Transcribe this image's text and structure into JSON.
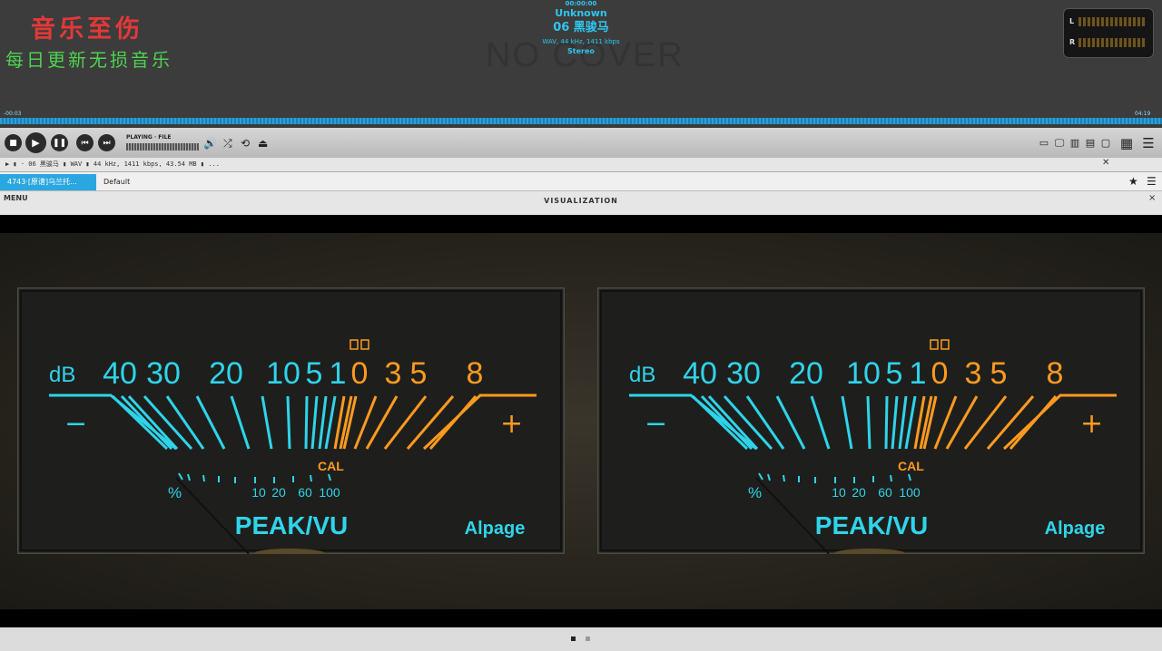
{
  "watermark": {
    "line1": "音乐至伤",
    "line2": "每日更新无损音乐"
  },
  "now_playing": {
    "time": "00:00:00",
    "artist": "Unknown",
    "title": "06 黑骏马",
    "format": "WAV, 44 kHz, 1411 kbps",
    "channels": "Stereo",
    "cover_text": "NO COVER"
  },
  "level_meter": {
    "left_label": "L",
    "right_label": "R"
  },
  "seek": {
    "elapsed": "-00:03",
    "remaining": "04:19"
  },
  "controls": {
    "status_label": "PLAYING · FILE"
  },
  "info_bar": {
    "text": "▶ ▮ · 06 黑骏马 ▮ WAV ▮ 44 kHz, 1411 kbps, 43.54 MB ▮ ..."
  },
  "tabs": [
    {
      "label": "4743·[原谱]乌兰托..."
    },
    {
      "label": "Default"
    }
  ],
  "panel": {
    "menu_label": "MENU",
    "title": "VISUALIZATION",
    "close": "×"
  },
  "meters": [
    {
      "db_label": "dB",
      "scale_cyan": [
        "40",
        "30",
        "20",
        "10",
        "5",
        "1"
      ],
      "scale_orange": [
        "0",
        "3",
        "5",
        "8"
      ],
      "minus": "−",
      "plus": "+",
      "cal": "CAL",
      "percent_label": "%",
      "percent_ticks": [
        "10",
        "20",
        "60",
        "100"
      ],
      "brand": "PEAK/VU",
      "maker": "Alpage"
    },
    {
      "db_label": "dB",
      "scale_cyan": [
        "40",
        "30",
        "20",
        "10",
        "5",
        "1"
      ],
      "scale_orange": [
        "0",
        "3",
        "5",
        "8"
      ],
      "minus": "−",
      "plus": "+",
      "cal": "CAL",
      "percent_label": "%",
      "percent_ticks": [
        "10",
        "20",
        "60",
        "100"
      ],
      "brand": "PEAK/VU",
      "maker": "Alpage"
    }
  ],
  "colors": {
    "cyan": "#2fd4ea",
    "orange": "#ff9a1f",
    "accent": "#2aa7e0"
  }
}
